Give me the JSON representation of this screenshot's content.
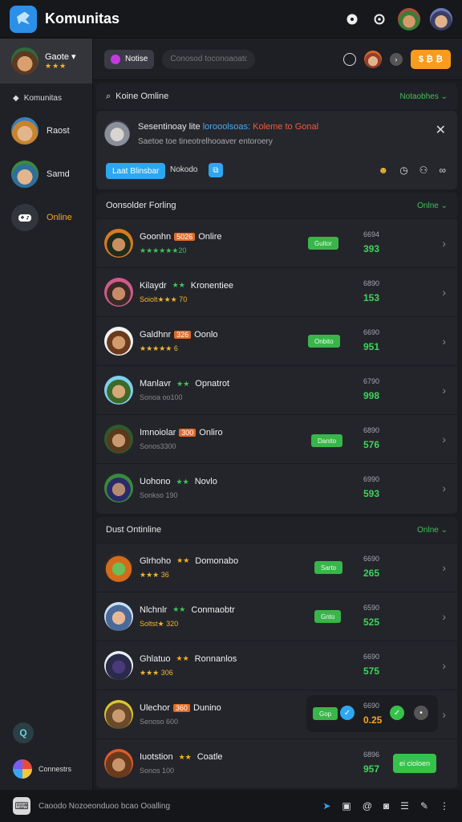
{
  "app": {
    "title": "Komunitas"
  },
  "topbar": {
    "icons": [
      "chat-icon",
      "settings-icon"
    ]
  },
  "sidebar": {
    "profile": {
      "name": "Gaote",
      "stars": "★★★"
    },
    "section_label": "Komunitas",
    "items": [
      {
        "label": "Raost"
      },
      {
        "label": "Samd"
      },
      {
        "label": "Online"
      }
    ],
    "footer_label": "Connestrs"
  },
  "filterbar": {
    "chip_label": "Notise",
    "search_placeholder": "Conosod toconoaoator",
    "cta_label": "$ ₿ ₿"
  },
  "notice_panel": {
    "header": "Koine Omline",
    "toggle": "Notaobhes",
    "title_prefix": "Sesentinoay lite",
    "title_blue": "lorooolsoas:",
    "title_red": "Koleme to Gonal",
    "subtitle": "Saetoe toe tineotrelhooaver entoroery",
    "primary_button": "Laat Blinsbar",
    "link_label": "Nokodo"
  },
  "online_section": {
    "header": "Oonsolder Forling",
    "toggle": "Onlne",
    "rows": [
      {
        "name": "Goonhn",
        "tag": "5026",
        "status": "Onlire",
        "sub": "★★★★★★20",
        "badge": "Guitor",
        "stat_label": "6694",
        "stat_value": "393"
      },
      {
        "name": "Kilaydr",
        "tag": "★★",
        "status": "Kronentiee",
        "sub": "Soiolt★★★ 70",
        "badge": "",
        "stat_label": "6890",
        "stat_value": "153"
      },
      {
        "name": "Galdhnr",
        "tag": "326",
        "status": "Oonlo",
        "sub": "★★★★★ 6",
        "badge": "Onbito",
        "stat_label": "6690",
        "stat_value": "951"
      },
      {
        "name": "Manlavr",
        "tag": "★★",
        "status": "Opnatrot",
        "sub": "Sonoa oo100",
        "badge": "",
        "stat_label": "6790",
        "stat_value": "998"
      },
      {
        "name": "Imnoiolar",
        "tag": "300",
        "status": "Onliro",
        "sub": "Sonos3300",
        "badge": "Danito",
        "stat_label": "6890",
        "stat_value": "576"
      },
      {
        "name": "Uohono",
        "tag": "★★",
        "status": "Novlo",
        "sub": "Sonkso 190",
        "badge": "",
        "stat_label": "6990",
        "stat_value": "593"
      }
    ]
  },
  "dust_section": {
    "header": "Dust Ontinline",
    "toggle": "Onlne",
    "rows": [
      {
        "name": "Glrhoho",
        "tag": "★★",
        "status": "Domonabo",
        "sub": "★★★ 36",
        "badge": "Sarto",
        "stat_label": "6690",
        "stat_value": "265"
      },
      {
        "name": "Nlchnlr",
        "tag": "★★",
        "status": "Conmaobtr",
        "sub": "Soltst★ 320",
        "badge": "Gnto",
        "stat_label": "6590",
        "stat_value": "525"
      },
      {
        "name": "Ghlatuo",
        "tag": "★★",
        "status": "Ronnanlos",
        "sub": "★★★ 306",
        "badge": "",
        "stat_label": "6690",
        "stat_value": "575"
      },
      {
        "name": "Ulechor",
        "tag": "360",
        "status": "Dunino",
        "sub": "Senoso 600",
        "badge": "Gop",
        "stat_label": "6690",
        "stat_value": "0.25"
      },
      {
        "name": "Iuotstion",
        "tag": "★★",
        "status": "Coatle",
        "sub": "Sonos 100",
        "badge": "",
        "stat_label": "6896",
        "stat_value": "957",
        "join": "ei cioloen"
      }
    ]
  },
  "bottombar": {
    "text": "Caoodo Nozoeonduoo bcao Ooalling"
  },
  "colors": {
    "accent": "#f99b1c",
    "online": "#3ec15a",
    "link": "#2da7f0",
    "background": "#1b1c20"
  }
}
